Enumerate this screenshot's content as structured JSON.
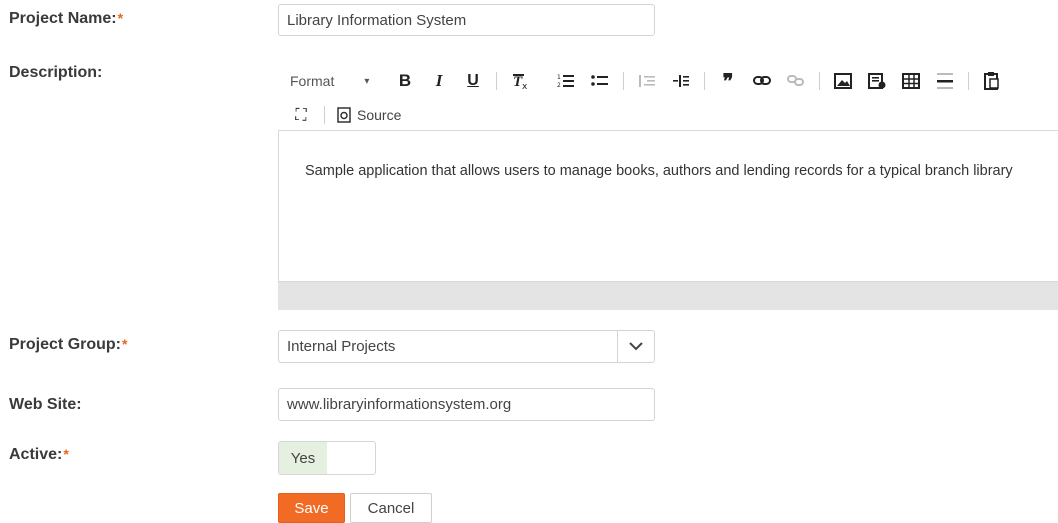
{
  "form": {
    "project_name": {
      "label": "Project Name:",
      "required": "*",
      "value": "Library Information System"
    },
    "description": {
      "label": "Description:",
      "content": "Sample application that allows users to manage books, authors and lending records for a typical branch library"
    },
    "project_group": {
      "label": "Project Group:",
      "required": "*",
      "value": "Internal Projects"
    },
    "web_site": {
      "label": "Web Site:",
      "value": "www.libraryinformationsystem.org"
    },
    "active": {
      "label": "Active:",
      "required": "*",
      "value": "Yes"
    }
  },
  "toolbar": {
    "format_label": "Format",
    "bold": "B",
    "italic": "I",
    "underline": "U",
    "source_label": "Source"
  },
  "buttons": {
    "save": "Save",
    "cancel": "Cancel"
  },
  "colors": {
    "accent": "#f26b25",
    "required": "#e8651a",
    "toggle_on": "#e6f0e1"
  }
}
